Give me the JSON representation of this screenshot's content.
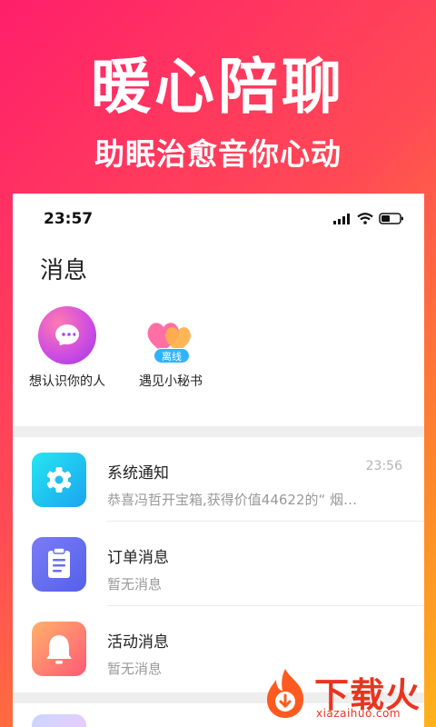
{
  "promo": {
    "title": "暖心陪聊",
    "subtitle": "助眠治愈音你心动"
  },
  "status_bar": {
    "time": "23:57",
    "icons": [
      "signal-icon",
      "wifi-icon",
      "battery-icon"
    ]
  },
  "page": {
    "title": "消息"
  },
  "quick_actions": [
    {
      "label": "想认识你的人",
      "icon": "chat-bubble-icon"
    },
    {
      "label": "遇见小秘书",
      "icon": "hearts-icon",
      "badge": "离线"
    }
  ],
  "messages": [
    {
      "title": "系统通知",
      "preview": "恭喜冯哲开宝箱,获得价值44622的“ 烟…",
      "time": "23:56",
      "icon": "gear-icon"
    },
    {
      "title": "订单消息",
      "preview": "暂无消息",
      "time": "",
      "icon": "clipboard-icon"
    },
    {
      "title": "活动消息",
      "preview": "暂无消息",
      "time": "",
      "icon": "bell-icon"
    }
  ],
  "watermark": {
    "text": "下载火",
    "url": "xiazaihuo.com"
  },
  "colors": {
    "gradient_start": "#ff1f6b",
    "gradient_end": "#ffb21a",
    "badge": "#2fb3ff",
    "time_gray": "#b5b5b5"
  }
}
